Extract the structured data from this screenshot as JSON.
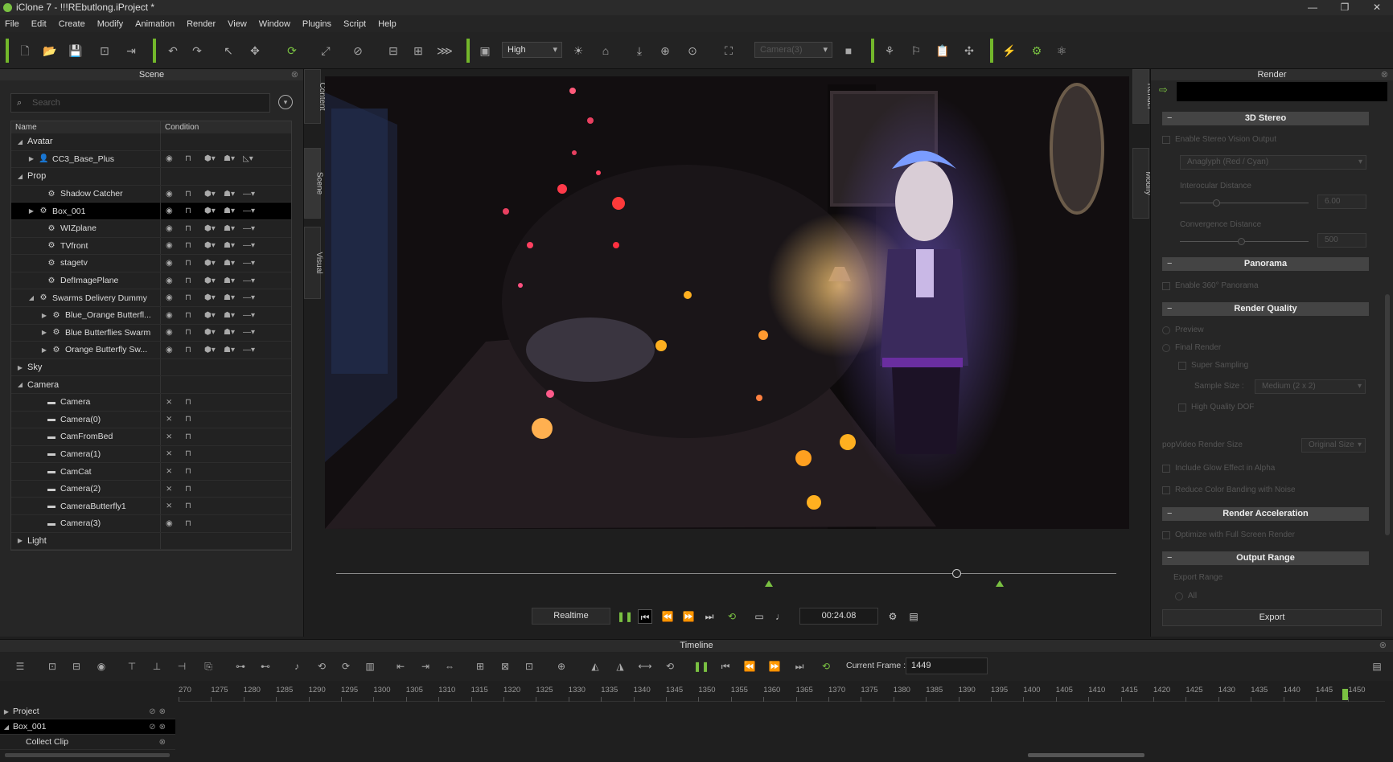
{
  "window": {
    "title": "iClone 7 - !!!REbutlong.iProject *"
  },
  "menu": [
    "File",
    "Edit",
    "Create",
    "Modify",
    "Animation",
    "Render",
    "View",
    "Window",
    "Plugins",
    "Script",
    "Help"
  ],
  "toolbar": {
    "quality": "High",
    "camera": "Camera(3)"
  },
  "scene": {
    "title": "Scene",
    "search_placeholder": "Search",
    "col_name": "Name",
    "col_condition": "Condition",
    "rows": [
      {
        "label": "Avatar",
        "group": true
      },
      {
        "label": "CC3_Base_Plus"
      },
      {
        "label": "Prop",
        "group": true
      },
      {
        "label": "Shadow Catcher"
      },
      {
        "label": "Box_001"
      },
      {
        "label": "WIZplane"
      },
      {
        "label": "TVfront"
      },
      {
        "label": "stagetv"
      },
      {
        "label": "DefImagePlane"
      },
      {
        "label": "Swarms Delivery Dummy"
      },
      {
        "label": "Blue_Orange Butterfl..."
      },
      {
        "label": "Blue Butterflies Swarm"
      },
      {
        "label": "Orange Butterfly Sw..."
      },
      {
        "label": "Sky",
        "group": true
      },
      {
        "label": "Camera",
        "group": true
      },
      {
        "label": "Camera"
      },
      {
        "label": "Camera(0)"
      },
      {
        "label": "CamFromBed"
      },
      {
        "label": "Camera(1)"
      },
      {
        "label": "CamCat"
      },
      {
        "label": "Camera(2)"
      },
      {
        "label": "CameraButterfly1"
      },
      {
        "label": "Camera(3)"
      },
      {
        "label": "Light",
        "group": true
      }
    ]
  },
  "side_tabs": {
    "content": "Content",
    "scene": "Scene",
    "visual": "Visual"
  },
  "playback": {
    "realtime": "Realtime",
    "time": "00:24.08"
  },
  "render": {
    "title": "Render",
    "tab_render": "Render",
    "tab_modify": "Modify",
    "sec_stereo": "3D Stereo",
    "enable_stereo": "Enable Stereo Vision Output",
    "anaglyph": "Anaglyph (Red / Cyan)",
    "interocular": "Interocular Distance",
    "interocular_val": "6.00",
    "convergence": "Convergence Distance",
    "convergence_val": "500",
    "sec_panorama": "Panorama",
    "enable_panorama": "Enable 360° Panorama",
    "sec_quality": "Render Quality",
    "preview": "Preview",
    "final_render": "Final Render",
    "super_sampling": "Super Sampling",
    "sample_size": "Sample Size :",
    "sample_size_val": "Medium (2 x 2)",
    "hq_dof": "High Quality DOF",
    "popvideo": "popVideo Render Size",
    "popvideo_val": "Original Size",
    "glow_alpha": "Include Glow Effect in Alpha",
    "reduce_banding": "Reduce Color Banding with Noise",
    "sec_accel": "Render Acceleration",
    "fullscreen": "Optimize with Full Screen Render",
    "sec_output": "Output Range",
    "export_range": "Export Range",
    "all": "All",
    "export": "Export"
  },
  "timeline": {
    "title": "Timeline",
    "current_frame_label": "Current Frame :",
    "current_frame": "1449",
    "ticks": [
      "270",
      "1275",
      "1280",
      "1285",
      "1290",
      "1295",
      "1300",
      "1305",
      "1310",
      "1315",
      "1320",
      "1325",
      "1330",
      "1335",
      "1340",
      "1345",
      "1350",
      "1355",
      "1360",
      "1365",
      "1370",
      "1375",
      "1380",
      "1385",
      "1390",
      "1395",
      "1400",
      "1405",
      "1410",
      "1415",
      "1420",
      "1425",
      "1430",
      "1435",
      "1440",
      "1445",
      "1450"
    ],
    "tracks": [
      "Project",
      "Box_001",
      "Collect Clip"
    ]
  }
}
